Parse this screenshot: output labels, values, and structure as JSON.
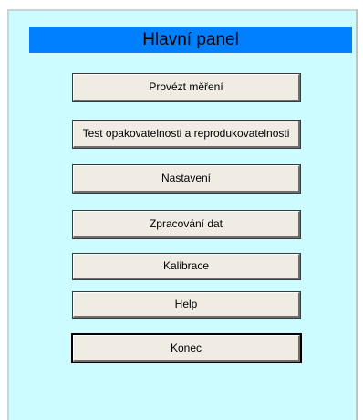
{
  "panel": {
    "title": "Hlavní panel",
    "title_bg_color": "#0080ff",
    "background_color": "#ccfcff"
  },
  "buttons": [
    {
      "label": "Provézt měření"
    },
    {
      "label": "Test opakovatelnosti a reprodukovatelnosti"
    },
    {
      "label": "Nastavení"
    },
    {
      "label": "Zpracování dat"
    },
    {
      "label": "Kalibrace"
    },
    {
      "label": "Help"
    },
    {
      "label": "Konec"
    }
  ]
}
